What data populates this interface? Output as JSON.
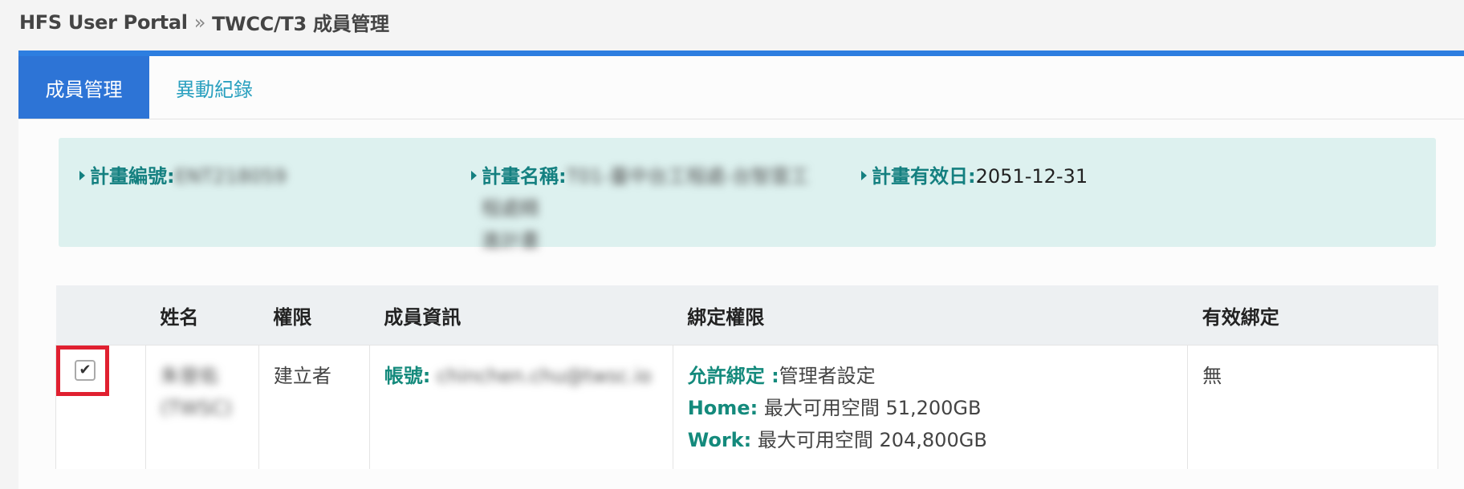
{
  "breadcrumb": {
    "root": "HFS User Portal",
    "separator": "»",
    "current": "TWCC/T3 成員管理"
  },
  "tabs": [
    {
      "label": "成員管理",
      "active": true
    },
    {
      "label": "異動紀錄",
      "active": false
    }
  ],
  "project": {
    "id_label": "計畫編號:",
    "id_value": "ENT218059",
    "name_label": "計畫名稱:",
    "name_value_line1": "T01-臺中台工程處-台智雲工程處精",
    "name_value_line2": "進計畫",
    "expiry_label": "計畫有效日:",
    "expiry_value": "2051-12-31"
  },
  "table": {
    "headers": [
      "",
      "姓名",
      "權限",
      "成員資訊",
      "綁定權限",
      "有效綁定"
    ],
    "rows": [
      {
        "checked": true,
        "name_line1": "朱晉佑",
        "name_line2": "(TWSC)",
        "role": "建立者",
        "account_label": "帳號:",
        "account_value": "chinchen.chu@twsc.io",
        "bind_allow_label": "允許綁定 :",
        "bind_allow_value": "管理者設定",
        "home_label": "Home:",
        "home_value": " 最大可用空間 51,200GB",
        "work_label": "Work:",
        "work_value": " 最大可用空間 204,800GB",
        "valid_binding": "無"
      }
    ]
  },
  "colors": {
    "accent": "#2d74d6",
    "teal": "#148080",
    "highlight": "#e02030"
  }
}
